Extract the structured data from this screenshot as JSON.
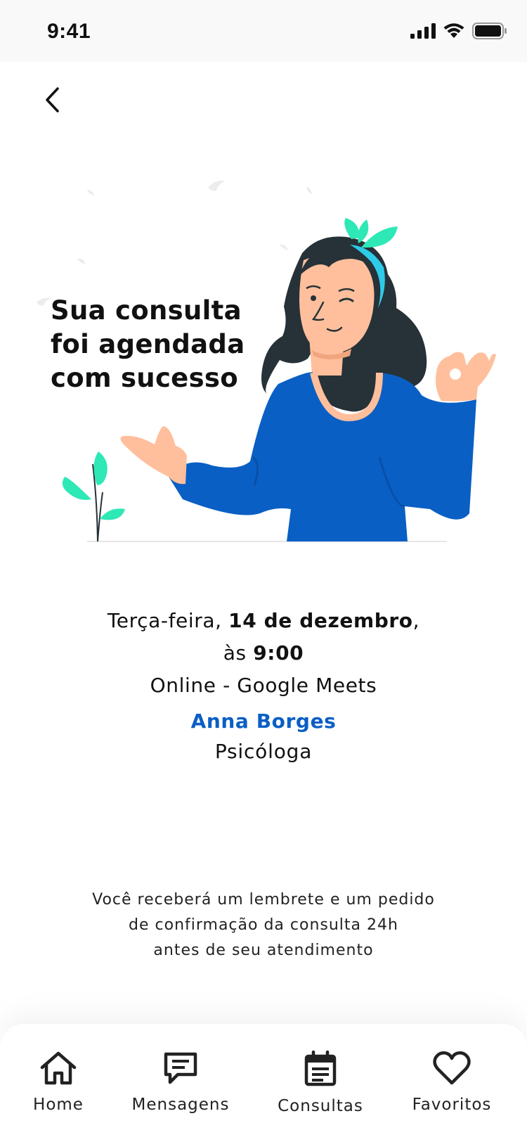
{
  "status_bar": {
    "time": "9:41"
  },
  "headline": [
    "Sua consulta",
    "foi agendada",
    "com sucesso"
  ],
  "appointment": {
    "day_prefix": "Terça-feira, ",
    "date": "14 de dezembro",
    "date_suffix": ",",
    "time_prefix": "às ",
    "time": "9:00",
    "location": "Online - Google Meets",
    "professional_name": "Anna Borges",
    "professional_role": "Psicóloga"
  },
  "reminder": [
    "Você receberá um lembrete e um pedido",
    "de confirmação da consulta 24h",
    "antes de seu atendimento"
  ],
  "tab_bar": [
    {
      "label": "Home",
      "icon": "home-icon"
    },
    {
      "label": "Mensagens",
      "icon": "message-icon"
    },
    {
      "label": "Consultas",
      "icon": "calendar-icon"
    },
    {
      "label": "Favoritos",
      "icon": "heart-icon"
    }
  ],
  "colors": {
    "accent_blue": "#0b5fc4",
    "shirt_blue": "#0a5fc4",
    "leaf_green": "#2ee8b6",
    "hair": "#263238",
    "skin": "#ffbf9c"
  }
}
